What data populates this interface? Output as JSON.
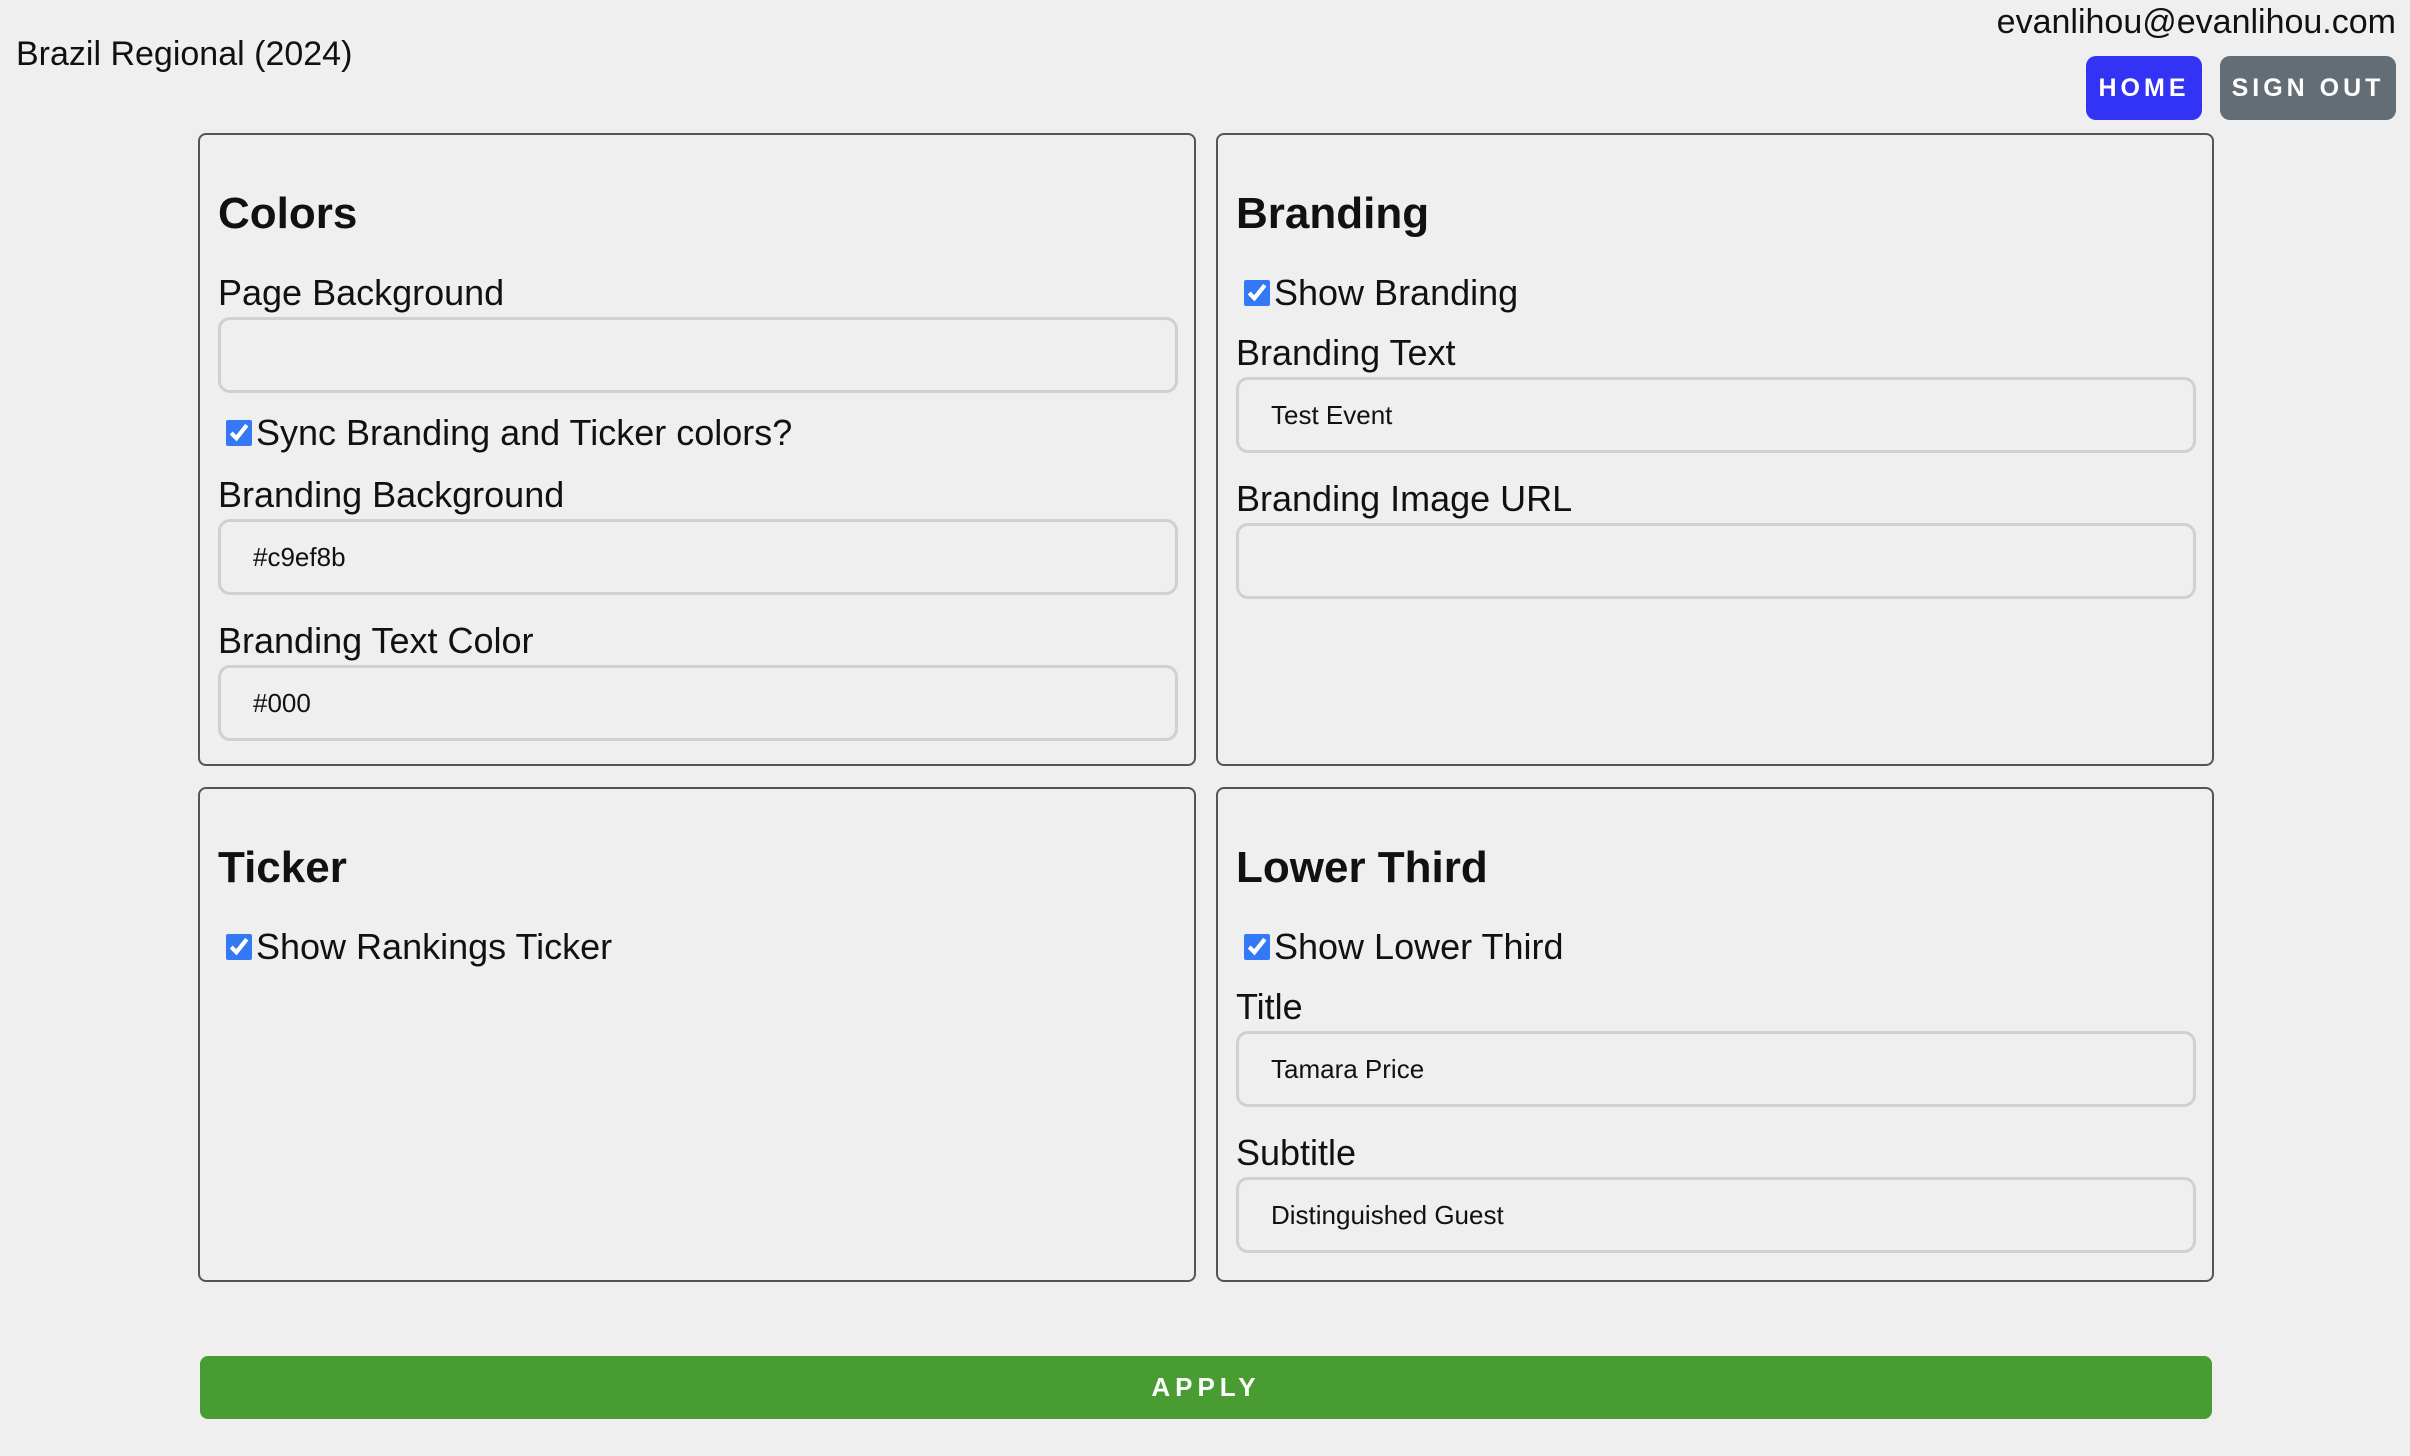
{
  "header": {
    "event_title": "Brazil Regional (2024)",
    "user_email": "evanlihou@evanlihou.com",
    "home_label": "HOME",
    "signout_label": "SIGN OUT"
  },
  "colors_panel": {
    "title": "Colors",
    "page_background_label": "Page Background",
    "page_background_value": "",
    "sync_label": "Sync Branding and Ticker colors?",
    "sync_checked": true,
    "branding_background_label": "Branding Background",
    "branding_background_value": "#c9ef8b",
    "branding_text_color_label": "Branding Text Color",
    "branding_text_color_value": "#000"
  },
  "branding_panel": {
    "title": "Branding",
    "show_branding_label": "Show Branding",
    "show_branding_checked": true,
    "branding_text_label": "Branding Text",
    "branding_text_value": "Test Event",
    "branding_image_url_label": "Branding Image URL",
    "branding_image_url_value": ""
  },
  "ticker_panel": {
    "title": "Ticker",
    "show_ticker_label": "Show Rankings Ticker",
    "show_ticker_checked": true
  },
  "lower_third_panel": {
    "title": "Lower Third",
    "show_lower_third_label": "Show Lower Third",
    "show_lower_third_checked": true,
    "title_label": "Title",
    "title_value": "Tamara Price",
    "subtitle_label": "Subtitle",
    "subtitle_value": "Distinguished Guest"
  },
  "apply_label": "APPLY",
  "theme": {
    "home_button_color": "#3333f5",
    "signout_button_color": "#636d75",
    "apply_button_color": "#489c31",
    "checkbox_color": "#3478f6",
    "page_background": "#efefef"
  }
}
